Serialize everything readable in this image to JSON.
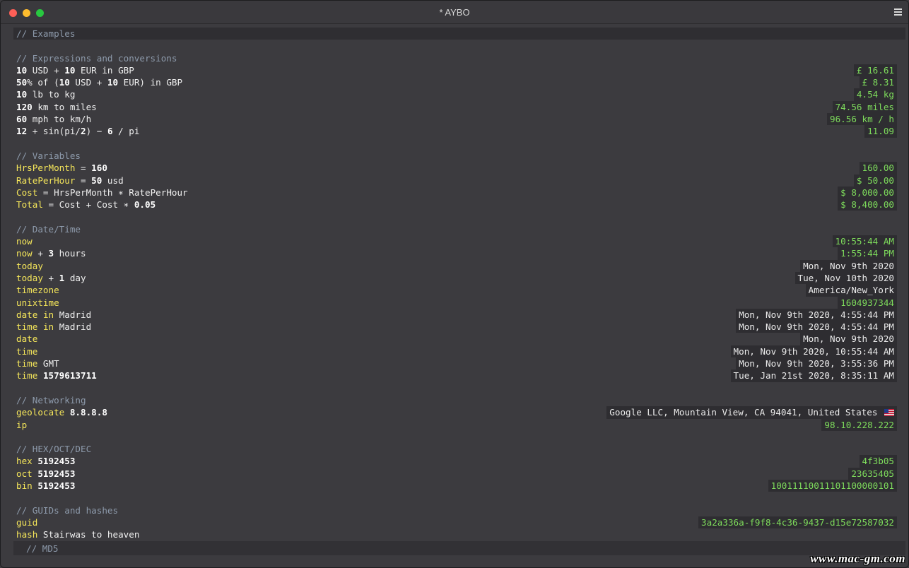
{
  "window": {
    "title": "* AYBO"
  },
  "lines": [
    {
      "segments": [
        {
          "t": "// Examples",
          "c": "comment"
        }
      ],
      "result": "",
      "highlight": true
    },
    {
      "segments": [],
      "result": ""
    },
    {
      "segments": [
        {
          "t": "// Expressions and conversions",
          "c": "comment"
        }
      ],
      "result": ""
    },
    {
      "segments": [
        {
          "t": "10",
          "c": "num-lit"
        },
        {
          "t": " USD + ",
          "c": "plain"
        },
        {
          "t": "10",
          "c": "num-lit"
        },
        {
          "t": " EUR in GBP",
          "c": "plain"
        }
      ],
      "result": "£ 16.61",
      "result_type": "num"
    },
    {
      "segments": [
        {
          "t": "50",
          "c": "num-lit"
        },
        {
          "t": "% of (",
          "c": "plain"
        },
        {
          "t": "10",
          "c": "num-lit"
        },
        {
          "t": " USD + ",
          "c": "plain"
        },
        {
          "t": "10",
          "c": "num-lit"
        },
        {
          "t": " EUR) in GBP",
          "c": "plain"
        }
      ],
      "result": "£ 8.31",
      "result_type": "num"
    },
    {
      "segments": [
        {
          "t": "10",
          "c": "num-lit"
        },
        {
          "t": " lb to kg",
          "c": "plain"
        }
      ],
      "result": "4.54 kg",
      "result_type": "num"
    },
    {
      "segments": [
        {
          "t": "120",
          "c": "num-lit"
        },
        {
          "t": " km to miles",
          "c": "plain"
        }
      ],
      "result": "74.56 miles",
      "result_type": "num"
    },
    {
      "segments": [
        {
          "t": "60",
          "c": "num-lit"
        },
        {
          "t": " mph to km/h",
          "c": "plain"
        }
      ],
      "result": "96.56 km / h",
      "result_type": "num"
    },
    {
      "segments": [
        {
          "t": "12",
          "c": "num-lit"
        },
        {
          "t": " + sin(pi/",
          "c": "plain"
        },
        {
          "t": "2",
          "c": "num-lit"
        },
        {
          "t": ") − ",
          "c": "plain"
        },
        {
          "t": "6",
          "c": "num-lit"
        },
        {
          "t": " / pi",
          "c": "plain"
        }
      ],
      "result": "11.09",
      "result_type": "num"
    },
    {
      "segments": [],
      "result": ""
    },
    {
      "segments": [
        {
          "t": "// Variables",
          "c": "comment"
        }
      ],
      "result": ""
    },
    {
      "segments": [
        {
          "t": "HrsPerMonth",
          "c": "kw"
        },
        {
          "t": " = ",
          "c": "plain"
        },
        {
          "t": "160",
          "c": "num-lit"
        }
      ],
      "result": "160.00",
      "result_type": "num"
    },
    {
      "segments": [
        {
          "t": "RatePerHour",
          "c": "kw"
        },
        {
          "t": " = ",
          "c": "plain"
        },
        {
          "t": "50",
          "c": "num-lit"
        },
        {
          "t": " usd",
          "c": "plain"
        }
      ],
      "result": "$ 50.00",
      "result_type": "num"
    },
    {
      "segments": [
        {
          "t": "Cost",
          "c": "kw"
        },
        {
          "t": " = HrsPerMonth ∗ RatePerHour",
          "c": "plain"
        }
      ],
      "result": "$ 8,000.00",
      "result_type": "num"
    },
    {
      "segments": [
        {
          "t": "Total",
          "c": "kw"
        },
        {
          "t": " = Cost + Cost ∗ ",
          "c": "plain"
        },
        {
          "t": "0.05",
          "c": "num-lit"
        }
      ],
      "result": "$ 8,400.00",
      "result_type": "num"
    },
    {
      "segments": [],
      "result": ""
    },
    {
      "segments": [
        {
          "t": "// Date/Time",
          "c": "comment"
        }
      ],
      "result": ""
    },
    {
      "segments": [
        {
          "t": "now",
          "c": "kw"
        }
      ],
      "result": "10:55:44 AM",
      "result_type": "num"
    },
    {
      "segments": [
        {
          "t": "now",
          "c": "kw"
        },
        {
          "t": " + ",
          "c": "plain"
        },
        {
          "t": "3",
          "c": "num-lit"
        },
        {
          "t": " hours",
          "c": "plain"
        }
      ],
      "result": "1:55:44 PM",
      "result_type": "num"
    },
    {
      "segments": [
        {
          "t": "today",
          "c": "kw"
        }
      ],
      "result": "Mon, Nov 9th 2020",
      "result_type": "text"
    },
    {
      "segments": [
        {
          "t": "today",
          "c": "kw"
        },
        {
          "t": " + ",
          "c": "plain"
        },
        {
          "t": "1",
          "c": "num-lit"
        },
        {
          "t": " day",
          "c": "plain"
        }
      ],
      "result": "Tue, Nov 10th 2020",
      "result_type": "text"
    },
    {
      "segments": [
        {
          "t": "timezone",
          "c": "kw"
        }
      ],
      "result": "America/New_York",
      "result_type": "text"
    },
    {
      "segments": [
        {
          "t": "unixtime",
          "c": "kw"
        }
      ],
      "result": "1604937344",
      "result_type": "num"
    },
    {
      "segments": [
        {
          "t": "date",
          "c": "kw"
        },
        {
          "t": " ",
          "c": "plain"
        },
        {
          "t": "in",
          "c": "kw"
        },
        {
          "t": " Madrid",
          "c": "plain"
        }
      ],
      "result": "Mon, Nov 9th 2020, 4:55:44 PM",
      "result_type": "text"
    },
    {
      "segments": [
        {
          "t": "time",
          "c": "kw"
        },
        {
          "t": " ",
          "c": "plain"
        },
        {
          "t": "in",
          "c": "kw"
        },
        {
          "t": " Madrid",
          "c": "plain"
        }
      ],
      "result": "Mon, Nov 9th 2020, 4:55:44 PM",
      "result_type": "text"
    },
    {
      "segments": [
        {
          "t": "date",
          "c": "kw"
        }
      ],
      "result": "Mon, Nov 9th 2020",
      "result_type": "text"
    },
    {
      "segments": [
        {
          "t": "time",
          "c": "kw"
        }
      ],
      "result": "Mon, Nov 9th 2020, 10:55:44 AM",
      "result_type": "text"
    },
    {
      "segments": [
        {
          "t": "time",
          "c": "kw"
        },
        {
          "t": " GMT",
          "c": "plain"
        }
      ],
      "result": "Mon, Nov 9th 2020, 3:55:36 PM",
      "result_type": "text"
    },
    {
      "segments": [
        {
          "t": "time",
          "c": "kw"
        },
        {
          "t": " ",
          "c": "plain"
        },
        {
          "t": "1579613711",
          "c": "num-lit"
        }
      ],
      "result": "Tue, Jan 21st 2020, 8:35:11 AM",
      "result_type": "text"
    },
    {
      "segments": [],
      "result": ""
    },
    {
      "segments": [
        {
          "t": "// Networking",
          "c": "comment"
        }
      ],
      "result": ""
    },
    {
      "segments": [
        {
          "t": "geolocate",
          "c": "kw"
        },
        {
          "t": " ",
          "c": "plain"
        },
        {
          "t": "8.8.8.8",
          "c": "num-lit"
        }
      ],
      "result": "Google LLC, Mountain View, CA 94041, United States",
      "result_type": "text",
      "flag": "us-flag-icon"
    },
    {
      "segments": [
        {
          "t": "ip",
          "c": "kw"
        }
      ],
      "result": "98.10.228.222",
      "result_type": "num"
    },
    {
      "segments": [],
      "result": ""
    },
    {
      "segments": [
        {
          "t": "// HEX/OCT/DEC",
          "c": "comment"
        }
      ],
      "result": ""
    },
    {
      "segments": [
        {
          "t": "hex",
          "c": "kw"
        },
        {
          "t": " ",
          "c": "plain"
        },
        {
          "t": "5192453",
          "c": "num-lit"
        }
      ],
      "result": "4f3b05",
      "result_type": "num"
    },
    {
      "segments": [
        {
          "t": "oct",
          "c": "kw"
        },
        {
          "t": " ",
          "c": "plain"
        },
        {
          "t": "5192453",
          "c": "num-lit"
        }
      ],
      "result": "23635405",
      "result_type": "num"
    },
    {
      "segments": [
        {
          "t": "bin",
          "c": "kw"
        },
        {
          "t": " ",
          "c": "plain"
        },
        {
          "t": "5192453",
          "c": "num-lit"
        }
      ],
      "result": "10011110011101100000101",
      "result_type": "num"
    },
    {
      "segments": [],
      "result": ""
    },
    {
      "segments": [
        {
          "t": "// GUIDs and hashes",
          "c": "comment"
        }
      ],
      "result": ""
    },
    {
      "segments": [
        {
          "t": "guid",
          "c": "kw"
        }
      ],
      "result": "3a2a336a-f9f8-4c36-9437-d15e72587032",
      "result_type": "num"
    },
    {
      "segments": [
        {
          "t": "hash",
          "c": "kw"
        },
        {
          "t": " Stairwas to heaven",
          "c": "plain"
        }
      ],
      "result": ""
    }
  ],
  "bottom_line": "// MD5",
  "watermark": "www.mac-gm.com",
  "colors": {
    "comment": "#8d9aab",
    "keyword": "#f5e65a",
    "result_number": "#7edc5c",
    "background": "#3c3b3f"
  }
}
